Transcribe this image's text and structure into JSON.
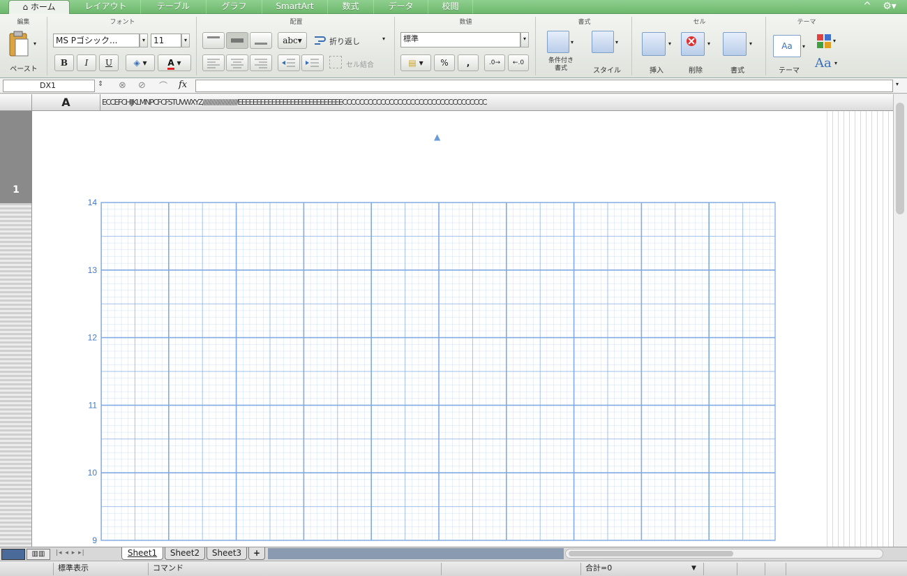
{
  "ribbon_tabs": [
    "ホーム",
    "レイアウト",
    "テーブル",
    "グラフ",
    "SmartArt",
    "数式",
    "データ",
    "校閲"
  ],
  "window_controls": {
    "collapse": "^",
    "settings": "⚙"
  },
  "groups": {
    "edit": {
      "label": "編集",
      "paste": "ペースト"
    },
    "font": {
      "label": "フォント",
      "name": "MS Pゴシック...",
      "size": "11",
      "bold": "B",
      "italic": "I",
      "underline": "U",
      "color": "A"
    },
    "align": {
      "label": "配置",
      "wrap": "折り返し",
      "abc": "abc",
      "merge": "セル結合"
    },
    "number": {
      "label": "数値",
      "format": "標準",
      "percent": "%",
      "comma": ","
    },
    "styles": {
      "label": "書式",
      "conditional": "条件付き\n書式",
      "style": "スタイル"
    },
    "cells": {
      "label": "セル",
      "insert": "挿入",
      "delete": "削除",
      "format": "書式"
    },
    "theme": {
      "label": "テーマ",
      "themes": "テーマ",
      "fonts": "Aa"
    }
  },
  "formula_bar": {
    "name_box": "DX1",
    "fx": "fx",
    "value": ""
  },
  "column_header": {
    "first": "A",
    "rest": "ECCEFCHIJKLMNPCFCFSTUVWXYZ////////////////////////EEEEEEEEEEEEEEEEEEEEEEEEEEEECCCCCCCCCCCCCCCCCCCCCCCCCCCCCCCCCC"
  },
  "row_number": "1",
  "chart_data": {
    "type": "scatter",
    "title": "",
    "xlabel": "",
    "ylabel": "",
    "y_ticks": [
      "14",
      "13",
      "12",
      "11",
      "10",
      "9"
    ],
    "ylim": [
      9,
      14
    ],
    "grid": true,
    "series": [],
    "colors": {
      "grid": "#7aa6e0",
      "tick": "#3a7bd5"
    }
  },
  "sheet_tabs": [
    "Sheet1",
    "Sheet2",
    "Sheet3"
  ],
  "add_sheet": "+",
  "status": {
    "view": "標準表示",
    "mode": "コマンド",
    "sum": "合計=0"
  }
}
